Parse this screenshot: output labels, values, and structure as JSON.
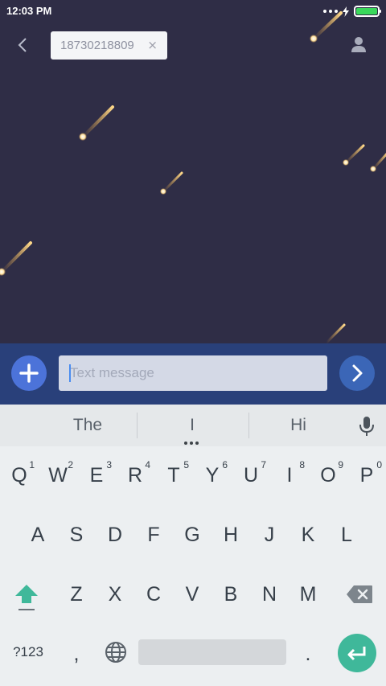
{
  "status_bar": {
    "time": "12:03 PM",
    "battery_level": 1.0,
    "battery_color": "#3ad85b"
  },
  "header": {
    "back_icon": "chevron-left-icon",
    "recipient": "18730218809",
    "recipient_remove_glyph": "×",
    "contact_icon": "person-icon"
  },
  "compose": {
    "add_icon": "plus-icon",
    "message_placeholder": "Text message",
    "message_value": "",
    "send_icon": "chevron-right-icon"
  },
  "keyboard": {
    "suggestions": [
      "The",
      "I",
      "Hi"
    ],
    "mic_icon": "microphone-icon",
    "row1": [
      {
        "label": "Q",
        "hint": "1"
      },
      {
        "label": "W",
        "hint": "2"
      },
      {
        "label": "E",
        "hint": "3"
      },
      {
        "label": "R",
        "hint": "4"
      },
      {
        "label": "T",
        "hint": "5"
      },
      {
        "label": "Y",
        "hint": "6"
      },
      {
        "label": "U",
        "hint": "7"
      },
      {
        "label": "I",
        "hint": "8"
      },
      {
        "label": "O",
        "hint": "9"
      },
      {
        "label": "P",
        "hint": "0"
      }
    ],
    "row2": [
      "A",
      "S",
      "D",
      "F",
      "G",
      "H",
      "J",
      "K",
      "L"
    ],
    "row3": [
      "Z",
      "X",
      "C",
      "V",
      "B",
      "N",
      "M"
    ],
    "shift_icon": "shift-arrow-icon",
    "backspace_icon": "backspace-icon",
    "symbols_label": "?123",
    "comma_label": ",",
    "globe_icon": "globe-icon",
    "period_label": ".",
    "enter_icon": "enter-arrow-icon",
    "accent_color": "#3fb89a"
  }
}
